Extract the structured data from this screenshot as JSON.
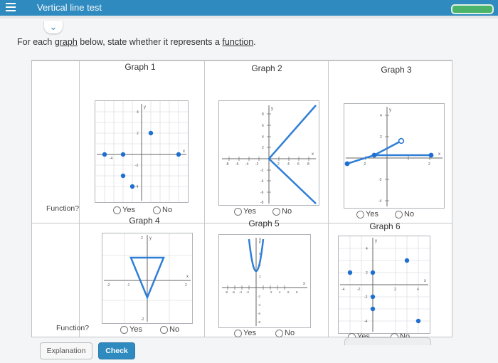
{
  "app": {
    "title": "Vertical line test"
  },
  "instructions": {
    "prefix": "For each ",
    "link1": "graph",
    "middle": " below, state whether it represents a ",
    "link2": "function",
    "suffix": "."
  },
  "row_label": "Function?",
  "options": {
    "yes": "Yes",
    "no": "No"
  },
  "graphs": [
    {
      "title": "Graph 1",
      "x_ticks": [
        "-4"
      ],
      "y_ticks": [
        "4",
        "2",
        "-2",
        "-4"
      ],
      "axis_x": "x",
      "axis_y": "y",
      "points": [
        [
          -4,
          0
        ],
        [
          -2,
          0
        ],
        [
          2,
          0
        ],
        [
          4,
          0
        ],
        [
          -2,
          -2
        ],
        [
          0,
          -4
        ],
        [
          2,
          2
        ]
      ]
    },
    {
      "title": "Graph 2",
      "x_ticks": [
        "-8",
        "-6",
        "-4",
        "-2",
        "2",
        "4",
        "6",
        "8"
      ],
      "y_ticks": [
        "8",
        "6",
        "4",
        "2",
        "-2",
        "-4",
        "-6",
        "-8"
      ],
      "axis_x": "x",
      "axis_y": "y",
      "vertex": [
        0,
        0
      ],
      "ends": [
        [
          8,
          8
        ],
        [
          8,
          -8
        ]
      ]
    },
    {
      "title": "Graph 3",
      "x_ticks": [
        "-2",
        "2"
      ],
      "y_ticks": [
        "4",
        "2",
        "-2",
        "-4"
      ],
      "axis_x": "x",
      "axis_y": "y",
      "segments": [
        {
          "from": [
            -3,
            0
          ],
          "to": [
            0,
            1
          ],
          "open_end": false
        },
        {
          "from": [
            0,
            1
          ],
          "to": [
            1.5,
            2
          ],
          "open_end": true
        },
        {
          "from": [
            0,
            1
          ],
          "to": [
            4,
            1
          ]
        }
      ],
      "closed_points": [
        [
          -3,
          0
        ],
        [
          0,
          1
        ],
        [
          4,
          1
        ]
      ],
      "open_points": [
        [
          1.5,
          2
        ]
      ]
    },
    {
      "title": "Graph 4",
      "x_ticks": [
        "-2",
        "-1",
        "2"
      ],
      "y_ticks": [
        "2",
        "-2"
      ],
      "axis_x": "x",
      "axis_y": "y",
      "triangle": [
        [
          -1,
          1
        ],
        [
          1,
          1
        ],
        [
          0,
          -1
        ]
      ]
    },
    {
      "title": "Graph 5",
      "x_ticks": [
        "-8",
        "-6",
        "-4",
        "-2",
        "2",
        "4",
        "6",
        "8"
      ],
      "y_ticks": [
        "8",
        "6",
        "4",
        "2",
        "-2",
        "-4",
        "-6",
        "-8"
      ],
      "axis_x": "x",
      "axis_y": "y"
    },
    {
      "title": "Graph 6",
      "x_ticks": [
        "-4",
        "-2",
        "2",
        "4"
      ],
      "y_ticks": [
        "4",
        "2",
        "-2",
        "-4"
      ],
      "axis_x": "x",
      "axis_y": "y",
      "points": [
        [
          -3,
          1
        ],
        [
          0,
          1
        ],
        [
          3,
          2
        ],
        [
          0,
          -1
        ],
        [
          0,
          -2
        ],
        [
          4,
          -3
        ]
      ]
    }
  ],
  "buttons": {
    "explanation": "Explanation",
    "check": "Check"
  },
  "colors": {
    "accent": "#2f8bbf",
    "point": "#1f6fd1",
    "line": "#2f7fd6",
    "success": "#4bb46a"
  }
}
